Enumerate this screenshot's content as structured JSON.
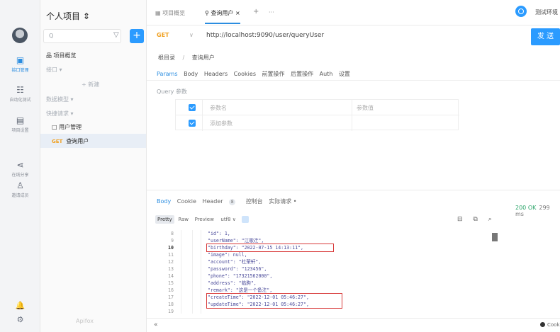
{
  "rail": {
    "items": [
      {
        "glyph": "▣",
        "label": "接口管理",
        "icon": "api-management-icon"
      },
      {
        "glyph": "☷",
        "label": "自动化测试",
        "icon": "automation-test-icon"
      },
      {
        "glyph": "▤",
        "label": "项目设置",
        "icon": "project-settings-icon"
      },
      {
        "glyph": "⋖",
        "label": "在线分享",
        "icon": "share-icon"
      },
      {
        "glyph": "♙",
        "label": "邀请成员",
        "icon": "invite-member-icon"
      }
    ],
    "bottom": [
      "🔔",
      "⚙"
    ]
  },
  "tree": {
    "project_title": "个人项目 ⇕",
    "search_placeholder": "Q",
    "filter": "▽",
    "add": "+",
    "overview": "品 项目概览",
    "api_section": "接口 ▾",
    "new": "+ 新建",
    "data_model": "数据模型 ▾",
    "quick_request": "快捷请求 ▾",
    "folder": "□ 用户管理",
    "selected_method": "GET",
    "selected_name": "查询用户",
    "logo": "Apifox"
  },
  "tabs": {
    "items": [
      "▦ 项目概览",
      "⚲ 查询用户  ×",
      "+",
      "···"
    ],
    "env_label": "测试环境"
  },
  "request": {
    "method": "GET",
    "method_arrow": "∨",
    "url": "http://localhost:9090/user/queryUser",
    "send": "发 送",
    "breadcrumb_root": "根目录",
    "breadcrumb_sep": "/",
    "breadcrumb_current": "查询用户",
    "tabs": [
      "Params",
      "Body",
      "Headers",
      "Cookies",
      "前置操作",
      "后置操作",
      "Auth",
      "设置"
    ],
    "query_label": "Query 参数",
    "param_name_placeholder": "参数名",
    "param_value_placeholder": "参数值",
    "add_param_placeholder": "添加参数"
  },
  "response": {
    "tabs": [
      "Body",
      "Cookie",
      "Header",
      "控制台",
      "实际请求 •"
    ],
    "header_count": "8",
    "status": "200 OK",
    "time": "299 ms",
    "formats": [
      "Pretty",
      "Raw",
      "Preview"
    ],
    "encoding": "utf8 ∨",
    "tool_icons": "⊟ ⧉ ⌕",
    "lines": [
      {
        "n": "8",
        "text": "\"id\": 1,"
      },
      {
        "n": "9",
        "text": "\"userName\": \"江歌迁\","
      },
      {
        "n": "10",
        "text": "\"birthday\": \"2022-07-15 14:13:11\","
      },
      {
        "n": "11",
        "text": "\"image\": null,"
      },
      {
        "n": "12",
        "text": "\"account\": \"杜荣轩\","
      },
      {
        "n": "13",
        "text": "\"password\": \"123456\","
      },
      {
        "n": "14",
        "text": "\"phone\": \"17321562000\","
      },
      {
        "n": "15",
        "text": "\"address\": \"临朐\","
      },
      {
        "n": "16",
        "text": "\"remark\": \"这是一个备注\","
      },
      {
        "n": "17",
        "text": "\"createTime\": \"2022-12-01 05:46:27\","
      },
      {
        "n": "18",
        "text": "\"updateTime\": \"2022-12-01 05:46:27\","
      },
      {
        "n": "19",
        "text": ""
      }
    ]
  },
  "footer": {
    "collapse": "«",
    "cookie": "Cook"
  }
}
